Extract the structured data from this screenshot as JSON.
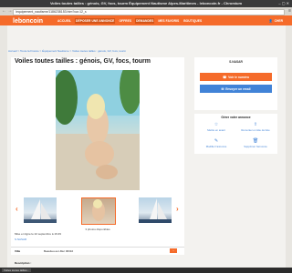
{
  "window": {
    "title": "Voiles toutes tailles : génois, GV, focs, tourm Équipement Nautisme Alpes-Maritimes - leboncoin.fr - Chromium",
    "url": "/equipement_nautisme/1186238153.htm?ca=12_s"
  },
  "header": {
    "logo": "leboncoin",
    "nav": [
      "ACCUEIL",
      "DÉPOSER UNE ANNONCE",
      "OFFRES",
      "DEMANDES",
      "MES FAVORIS",
      "BOUTIQUES"
    ],
    "connect_label": "CHER",
    "accent_color": "#f56b2a"
  },
  "breadcrumb": "Accueil > Toute la France > Équipement Nautisme > Voiles toutes tailles : génois, GV, focs, tourm",
  "ad": {
    "title": "Voiles toutes tailles : génois, GV, focs, tourm",
    "photo_count": "3 photos disponibles",
    "posted": "Mise en ligne le 22 septembre à 16:29",
    "seller": "S.NASAR",
    "fields": [
      {
        "label": "Ville",
        "value": "Beaulieu-sur-Mer 06310"
      }
    ],
    "description_label": "Description :"
  },
  "sidebar": {
    "seller_name": "S.NASAR",
    "phone_button": "Voir le numéro",
    "email_button": "Envoyer un email",
    "manage_title": "Gérer votre annonce",
    "actions": [
      "Mettre en avant",
      "Remonter en tête de liste",
      "Modifier l'annonce",
      "Supprimer l'annonce"
    ]
  },
  "taskbar": {
    "task": "Voiles toutes tailles..."
  }
}
